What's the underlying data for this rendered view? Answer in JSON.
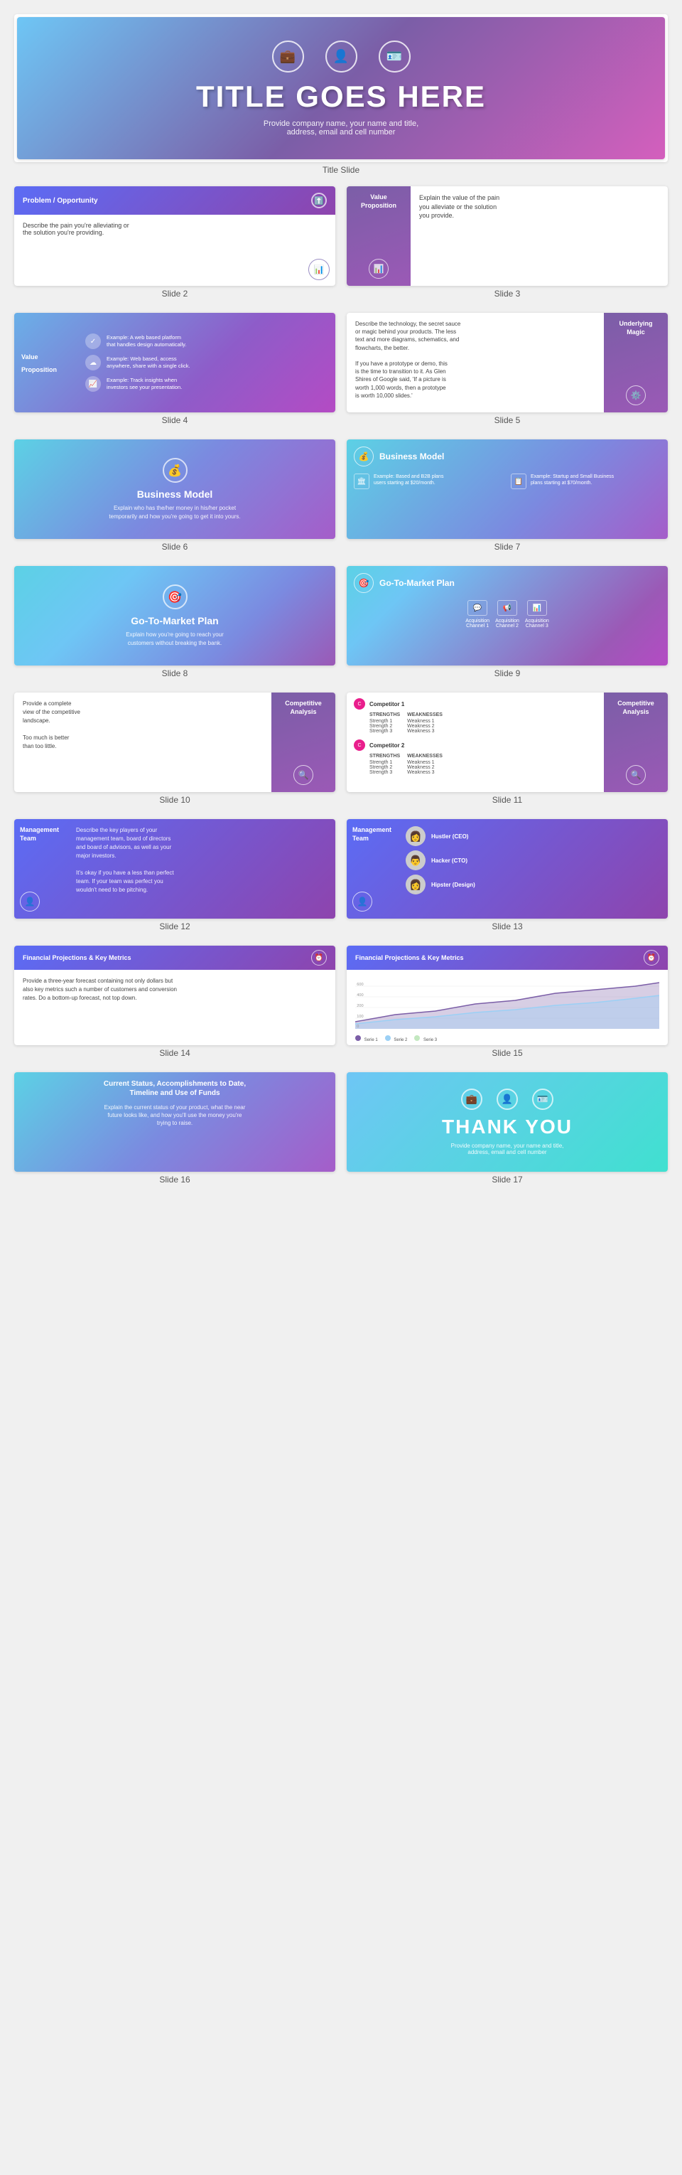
{
  "title_slide": {
    "title": "TITLE GOES HERE",
    "subtitle": "Provide company name, your name and title,\naddress, email and cell number",
    "label": "Title Slide",
    "icons": [
      "briefcase",
      "person",
      "id-card"
    ]
  },
  "slide2": {
    "header": "Problem / Opportunity",
    "body": "Describe the pain you're alleviating or\nthe solution you're providing.",
    "label": "Slide 2"
  },
  "slide3": {
    "left_label": "Value\nProposition",
    "right_text": "Explain the value of the pain\nyou alleviate or the solution\nyou provide.",
    "label": "Slide 3"
  },
  "slide4": {
    "left_label": "Value\nProposition",
    "examples": [
      {
        "text": "Example: A web based platform\nthat handles design automatically."
      },
      {
        "text": "Example: Web based, access\nanywhere, share with a single click."
      },
      {
        "text": "Example: Track insights when\ninvestors see your presentation."
      }
    ],
    "label": "Slide 4"
  },
  "slide5": {
    "left_text": "Describe the technology, the secret sauce\nor magic behind your products. The less\ntext and more diagrams, schematics, and\nflowcharts, the better.\n\nIf you have a prototype or demo, this\nis the time to transition to it. As Glen\nShires of Google said, 'If a picture is\nworth 1,000 words, then a prototype\nis worth 10,000 slides.'",
    "right_label": "Underlying\nMagic",
    "label": "Slide 5"
  },
  "slide6": {
    "title": "Business Model",
    "desc": "Explain who has the/her money in his/her pocket\ntemporarily and how you're going to get it into yours.",
    "label": "Slide 6"
  },
  "slide7": {
    "title": "Business Model",
    "examples": [
      {
        "text": "Example: Based and B2B plans\nusers starting at $20/month."
      },
      {
        "text": "Example: Startup and Small Business\nplans starting at $70/month."
      }
    ],
    "label": "Slide 7"
  },
  "slide8": {
    "title": "Go-To-Market Plan",
    "desc": "Explain how you're going to reach your\ncustomers without breaking the bank.",
    "label": "Slide 8"
  },
  "slide9": {
    "title": "Go-To-Market Plan",
    "channels": [
      {
        "label": "Acquisition\nChannel 1"
      },
      {
        "label": "Acquisition\nChannel 2"
      },
      {
        "label": "Acquisition\nChannel 3"
      }
    ],
    "label": "Slide 9"
  },
  "slide10": {
    "left_text": "Provide a complete\nview of the competitive\nlandscape.\n\nToo much is better\nthan too little.",
    "right_label": "Competitive\nAnalysis",
    "label": "Slide 10"
  },
  "slide11": {
    "competitors": [
      {
        "name": "Competitor 1",
        "strengths": [
          "Strength 1",
          "Strength 2",
          "Strength 3"
        ],
        "weaknesses": [
          "Weakness 1",
          "Weakness 2",
          "Weakness 3"
        ]
      },
      {
        "name": "Competitor 2",
        "strengths": [
          "Strength 1",
          "Strength 2",
          "Strength 3"
        ],
        "weaknesses": [
          "Weakness 1",
          "Weakness 2",
          "Weakness 3"
        ]
      }
    ],
    "right_label": "Competitive\nAnalysis",
    "label": "Slide 11"
  },
  "slide12": {
    "left_label": "Management\nTeam",
    "right_text": "Describe the key players of your\nmanagement team, board of directors\nand board of advisors, as well as your\nmajor investors.\n\nIt's okay if you have a less than perfect\nteam. If your team was perfect you\nwouldn't need to be pitching.",
    "label": "Slide 12"
  },
  "slide13": {
    "left_label": "Management\nTeam",
    "members": [
      {
        "role": "Hustler (CEO)",
        "emoji": "👩"
      },
      {
        "role": "Hacker (CTO)",
        "emoji": "👨"
      },
      {
        "role": "Hipster (Design)",
        "emoji": "👩"
      }
    ],
    "label": "Slide 13"
  },
  "slide14": {
    "header": "Financial Projections & Key Metrics",
    "body": "Provide a three-year forecast containing not only dollars but\nalso key metrics such a number of customers and conversion\nrates. Do a bottom-up forecast, not top down.",
    "label": "Slide 14"
  },
  "slide15": {
    "header": "Financial Projections & Key Metrics",
    "legend": [
      "Serie 1",
      "Serie 2",
      "Serie 3"
    ],
    "colors": [
      "#7b5ea7",
      "#9bd0f5",
      "#c3e8c0"
    ],
    "label": "Slide 15"
  },
  "slide16": {
    "title": "Current Status, Accomplishments to Date,\nTimeline and Use of Funds",
    "body": "Explain the current status of your product, what the near\nfuture looks like, and how you'll use the money you're\ntrying to raise.",
    "label": "Slide 16"
  },
  "slide17": {
    "title": "THANK YOU",
    "subtitle": "Provide company name, your name and title,\naddress, email and cell number",
    "label": "Slide 17",
    "icons": [
      "briefcase",
      "person",
      "id-card"
    ]
  }
}
